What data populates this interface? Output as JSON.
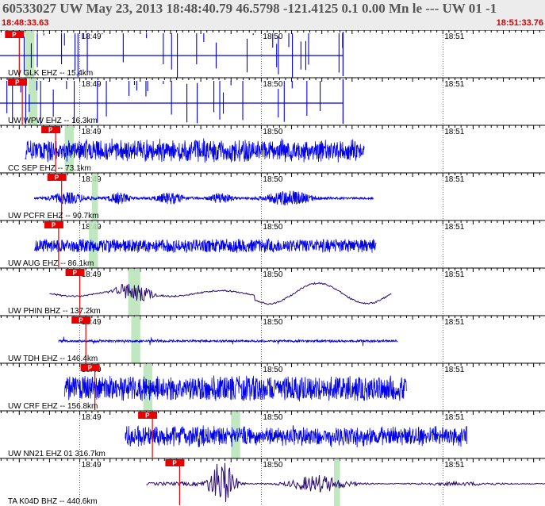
{
  "header": {
    "title": "60533027 UW May 23, 2013 18:48:40.79   46.5798 -121.4125  0.1 0.00 Mn le --- UW 01  -1",
    "time_start": "18:48:33.63",
    "time_end": "18:51:33.76"
  },
  "colors": {
    "header_bg": "#ececec",
    "trace_blue": "#0000e6",
    "trace_purple": "#2a0a6e",
    "pick_red": "#e60000",
    "highlight_green": "#b6e3b6",
    "time_text": "#d40000"
  },
  "time_axis": {
    "start_seconds": 33.63,
    "end_seconds": 213.76,
    "minute_marks": [
      {
        "label": "18:49",
        "seconds": 60
      },
      {
        "label": "18:50",
        "seconds": 120
      },
      {
        "label": "18:51",
        "seconds": 180
      }
    ]
  },
  "pick_label": "P",
  "traces": [
    {
      "label": "UW GLK EHZ -- 15.4km",
      "color": "blue",
      "style": "spiky",
      "start": 33.63,
      "end": 147,
      "amp": 1.0,
      "pick": 40,
      "green": [
        42,
        45
      ]
    },
    {
      "label": "UW WPW EHZ -- 16.3km",
      "color": "blue",
      "style": "spiky",
      "start": 33.63,
      "end": 147,
      "amp": 1.0,
      "pick": 41,
      "green": [
        43,
        46
      ]
    },
    {
      "label": "CC SEP EHZ -- 73.1km",
      "color": "blue",
      "style": "noise",
      "start": 42,
      "end": 154,
      "amp": 0.6,
      "pick": 52,
      "green": [
        55,
        58
      ]
    },
    {
      "label": "UW PCFR EHZ -- 90.7km",
      "color": "blue",
      "style": "bursts",
      "start": 45,
      "end": 157,
      "amp": 0.35,
      "pick": 54,
      "green": [
        64,
        66
      ]
    },
    {
      "label": "UW AUG EHZ -- 86.1km",
      "color": "blue",
      "style": "dense",
      "start": 45,
      "end": 158,
      "amp": 0.35,
      "pick": 53,
      "green": [
        63,
        66
      ]
    },
    {
      "label": "UW PHIN BHZ -- 137.2km",
      "color": "purple",
      "style": "wave",
      "start": 50,
      "end": 163,
      "amp": 0.55,
      "pick": 60,
      "green": [
        76,
        80
      ]
    },
    {
      "label": "UW TDH EHZ -- 146.4km",
      "color": "blue",
      "style": "quiet",
      "start": 53,
      "end": 165,
      "amp": 0.15,
      "pick": 62,
      "green": [
        77,
        80
      ]
    },
    {
      "label": "UW CRF EHZ -- 156.8km",
      "color": "blue",
      "style": "dense",
      "start": 55,
      "end": 168,
      "amp": 0.65,
      "pick": 65,
      "green": [
        81,
        84
      ]
    },
    {
      "label": "UW NN21 EHZ 01 316.7km",
      "color": "blue",
      "style": "noise",
      "start": 75,
      "end": 188,
      "amp": 0.55,
      "pick": 84,
      "green": [
        110,
        113
      ]
    },
    {
      "label": "TA K04D BHZ -- 440.6km",
      "color": "purple",
      "style": "teleseism",
      "start": 82,
      "end": 213.76,
      "amp": 0.7,
      "pick": 93,
      "green": [
        144,
        146
      ]
    }
  ]
}
